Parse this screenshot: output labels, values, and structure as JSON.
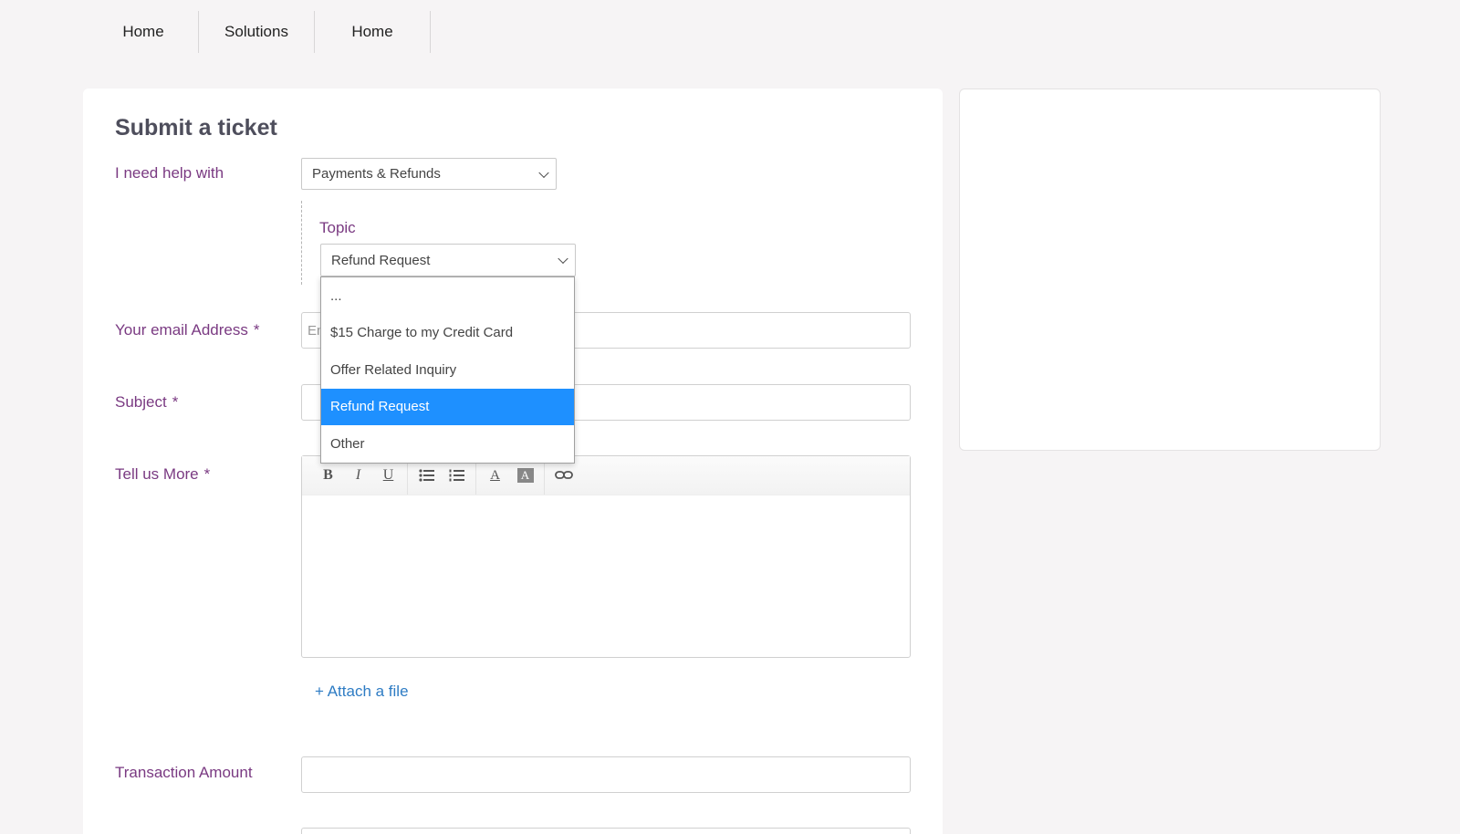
{
  "nav": {
    "items": [
      {
        "label": "Home"
      },
      {
        "label": "Solutions"
      },
      {
        "label": "Home"
      }
    ]
  },
  "form": {
    "title": "Submit a ticket",
    "help_label": "I need help with",
    "help_value": "Payments & Refunds",
    "topic_label": "Topic",
    "topic_value": "Refund Request",
    "topic_options": [
      "...",
      "$15 Charge to my Credit Card",
      "Offer Related Inquiry",
      "Refund Request",
      "Other"
    ],
    "topic_selected_index": 3,
    "email_label": "Your email Address",
    "email_placeholder": "Enter your email address",
    "email_visible_placeholder": "En",
    "subject_label": "Subject",
    "more_label": "Tell us More",
    "required_mark": "*",
    "attach_label": "+ Attach a file",
    "amount_label": "Transaction Amount"
  },
  "toolbar": {
    "bold": "B",
    "italic": "I",
    "underline": "U",
    "font_color": "A",
    "bg_color": "A"
  },
  "colors": {
    "accent_label": "#7a3a82",
    "link": "#2e7cc4",
    "selected_option": "#1e90ff"
  }
}
